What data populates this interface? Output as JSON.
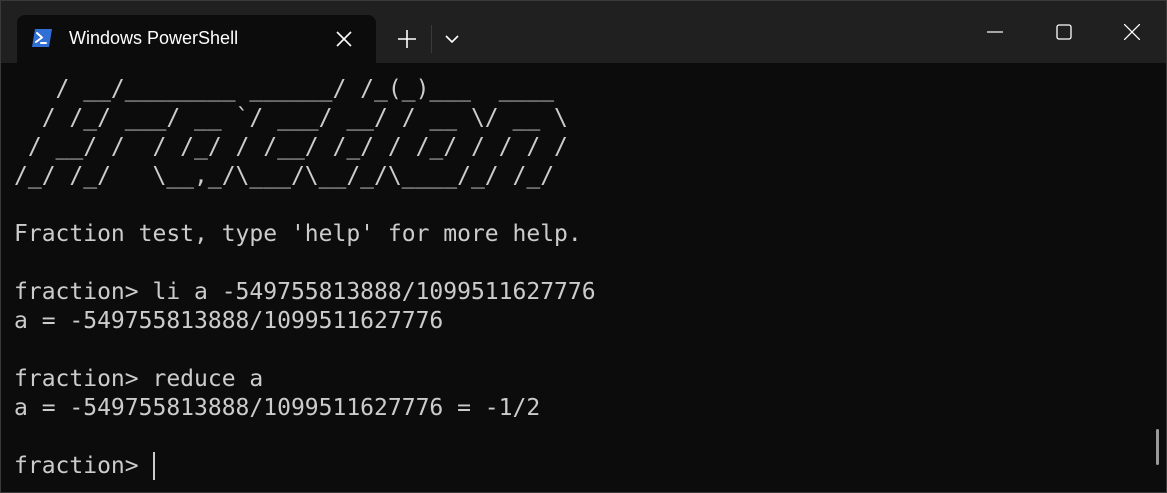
{
  "tab": {
    "title": "Windows PowerShell",
    "icon": "powershell-icon",
    "close_icon": "close-icon"
  },
  "toolbar": {
    "new_tab_icon": "plus-icon",
    "dropdown_icon": "chevron-down-icon"
  },
  "window_controls": {
    "minimize_icon": "minimize-icon",
    "maximize_icon": "maximize-icon",
    "close_icon": "close-icon"
  },
  "terminal": {
    "lines": [
      "   / __/________ ______/ /_(_)___  ____",
      "  / /_/ ___/ __ `/ ___/ __/ / __ \\/ __ \\",
      " / __/ /  / /_/ / /__/ /_/ / /_/ / / / /",
      "/_/ /_/   \\__,_/\\___/\\__/_/\\____/_/ /_/",
      "",
      "Fraction test, type 'help' for more help.",
      "",
      "fraction> li a -549755813888/1099511627776",
      "a = -549755813888/1099511627776",
      "",
      "fraction> reduce a",
      "a = -549755813888/1099511627776 = -1/2",
      "",
      "fraction> "
    ]
  },
  "colors": {
    "background": "#0c0c0c",
    "titlebar": "#202020",
    "text": "#cccccc",
    "powershell_blue": "#2f6fd6"
  }
}
